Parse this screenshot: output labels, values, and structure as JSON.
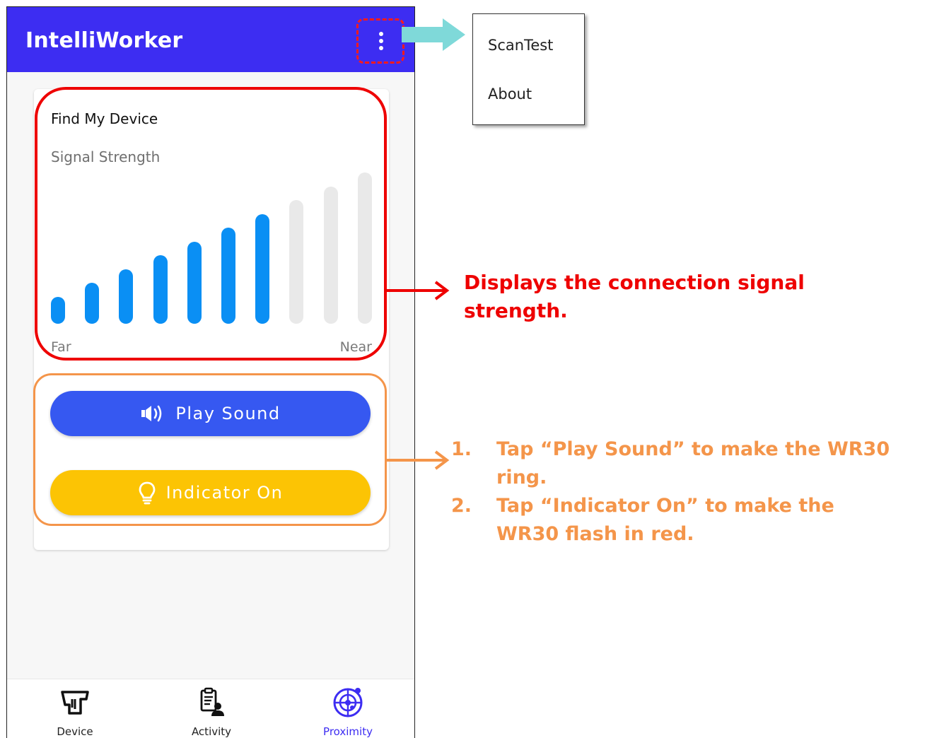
{
  "app": {
    "title": "IntelliWorker",
    "overflow_icon": "more-vert-icon"
  },
  "menu": {
    "items": [
      {
        "label": "ScanTest"
      },
      {
        "label": "About"
      }
    ]
  },
  "card": {
    "title": "Find My Device",
    "subtitle": "Signal Strength",
    "far_label": "Far",
    "near_label": "Near",
    "signal": {
      "total_bars": 10,
      "active_bars": 7,
      "active_color": "#0a8ff4",
      "inactive_color": "#e9e9e9"
    }
  },
  "buttons": {
    "play_sound": {
      "label": "Play Sound",
      "icon": "speaker-icon",
      "color": "#3658f1"
    },
    "indicator_on": {
      "label": "Indicator On",
      "icon": "lightbulb-icon",
      "color": "#fcc404"
    }
  },
  "bottom_nav": {
    "items": [
      {
        "label": "Device",
        "icon": "scanner-icon"
      },
      {
        "label": "Activity",
        "icon": "clipboard-user-icon"
      },
      {
        "label": "Proximity",
        "icon": "radar-icon",
        "active": true
      }
    ]
  },
  "annotations": {
    "signal_note": "Displays the connection signal strength.",
    "steps": [
      {
        "num": "1.",
        "text": "Tap “Play Sound” to make the WR30 ring."
      },
      {
        "num": "2.",
        "text": "Tap “Indicator On” to make the WR30 flash in red."
      }
    ],
    "colors": {
      "red": "#ee0000",
      "orange": "#f4954a",
      "teal_arrow": "#7fd9d9"
    }
  }
}
